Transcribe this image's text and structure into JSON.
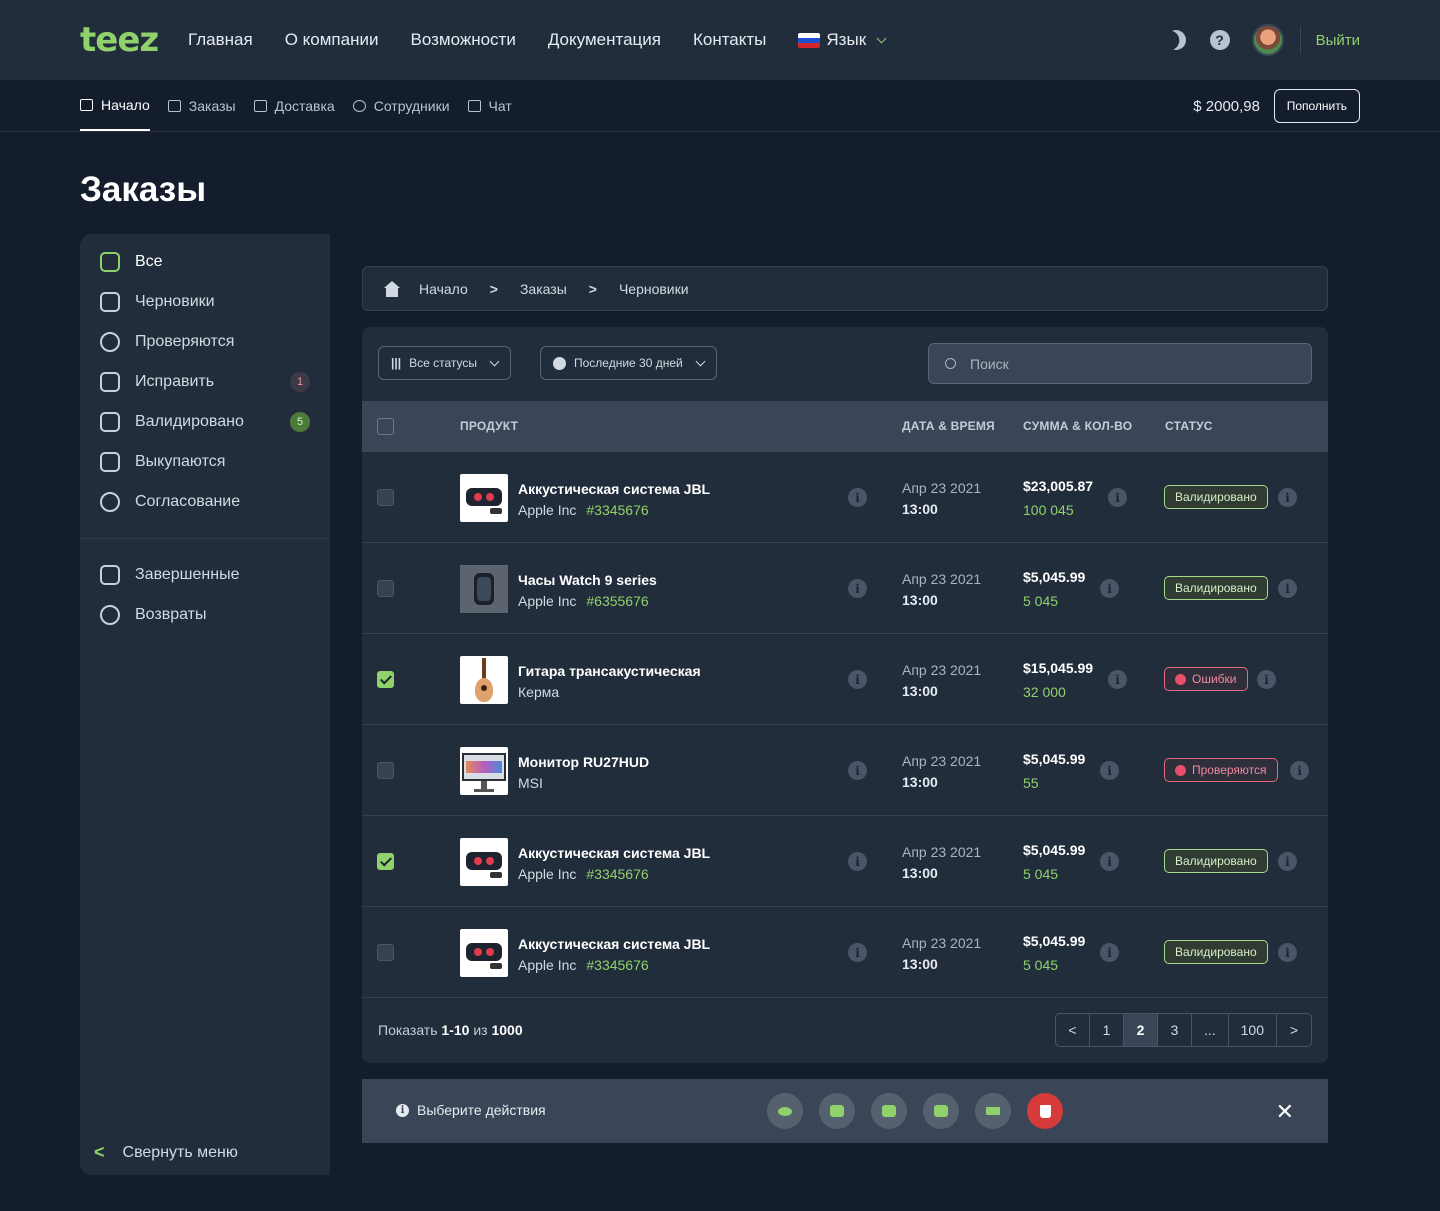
{
  "brand": {
    "logo": "teez"
  },
  "topnav": [
    "Главная",
    "О компании",
    "Возможности",
    "Документация",
    "Контакты"
  ],
  "language": {
    "label": "Язык"
  },
  "top_right": {
    "logout": "Выйти"
  },
  "subnav": [
    {
      "label": "Начало",
      "active": true,
      "icon": "home-icon"
    },
    {
      "label": "Заказы",
      "icon": "bag-icon"
    },
    {
      "label": "Доставка",
      "icon": "truck-icon"
    },
    {
      "label": "Сотрудники",
      "icon": "users-icon"
    },
    {
      "label": "Чат",
      "icon": "chat-icon"
    }
  ],
  "balance": "$ 2000,98",
  "topup_label": "Пополнить",
  "page_title": "Заказы",
  "sidebar": {
    "items": [
      {
        "label": "Все",
        "active": true,
        "icon": "shop-icon"
      },
      {
        "label": "Черновики",
        "icon": "drafts-icon"
      },
      {
        "label": "Проверяются",
        "icon": "review-icon"
      },
      {
        "label": "Исправить",
        "badge": "1",
        "badge_color": "#f08aa0",
        "icon": "basket-x-icon"
      },
      {
        "label": "Валидировано",
        "badge": "5",
        "badge_color": "#4c7a3a",
        "icon": "basket-check-icon"
      },
      {
        "label": "Выкупаются",
        "icon": "cart-icon"
      },
      {
        "label": "Согласование",
        "icon": "bag-approve-icon"
      }
    ],
    "items2": [
      {
        "label": "Завершенные",
        "icon": "archive-icon"
      },
      {
        "label": "Возвраты",
        "icon": "return-icon"
      }
    ],
    "collapse": "Свернуть меню"
  },
  "breadcrumb": [
    "Начало",
    "Заказы",
    "Черновики"
  ],
  "filters": {
    "status": "Все статусы",
    "period": "Последние 30 дней"
  },
  "search": {
    "placeholder": "Поиск"
  },
  "table": {
    "headers": [
      "ПРОДУКТ",
      "ДАТА & ВРЕМЯ",
      "СУММА & КОЛ-ВО",
      "СТАТУС"
    ],
    "rows": [
      {
        "name": "Аккустическая система JBL",
        "brand": "Apple Inc",
        "code": "#3345676",
        "date": "Апр 23 2021",
        "time": "13:00",
        "amount": "$23,005.87",
        "qty": "100 045",
        "status": "Валидировано",
        "status_type": "ok",
        "checked": false,
        "thumb": "speaker"
      },
      {
        "name": "Часы Watch 9 series",
        "brand": "Apple Inc",
        "code": "#6355676",
        "date": "Апр 23 2021",
        "time": "13:00",
        "amount": "$5,045.99",
        "qty": "5 045",
        "status": "Валидировано",
        "status_type": "ok",
        "checked": false,
        "thumb": "watch"
      },
      {
        "name": "Гитара трансакустическая",
        "brand": "Керма",
        "code": "",
        "date": "Апр 23 2021",
        "time": "13:00",
        "amount": "$15,045.99",
        "qty": "32 000",
        "status": "Ошибки",
        "status_type": "err",
        "checked": true,
        "thumb": "guitar"
      },
      {
        "name": "Монитор RU27HUD",
        "brand": "MSI",
        "code": "",
        "date": "Апр 23 2021",
        "time": "13:00",
        "amount": "$5,045.99",
        "qty": "55",
        "status": "Проверяются",
        "status_type": "err",
        "checked": false,
        "thumb": "monitor"
      },
      {
        "name": "Аккустическая система JBL",
        "brand": "Apple Inc",
        "code": "#3345676",
        "date": "Апр 23 2021",
        "time": "13:00",
        "amount": "$5,045.99",
        "qty": "5 045",
        "status": "Валидировано",
        "status_type": "ok",
        "checked": true,
        "thumb": "speaker"
      },
      {
        "name": "Аккустическая система JBL",
        "brand": "Apple Inc",
        "code": "#3345676",
        "date": "Апр 23 2021",
        "time": "13:00",
        "amount": "$5,045.99",
        "qty": "5 045",
        "status": "Валидировано",
        "status_type": "ok",
        "checked": false,
        "thumb": "speaker"
      }
    ]
  },
  "footer": {
    "prefix": "Показать",
    "range": "1-10",
    "of": "из",
    "total": "1000"
  },
  "pagination": [
    "1",
    "2",
    "3",
    "...",
    "100"
  ],
  "pagination_active": "2",
  "actions": {
    "label": "Выберите действия",
    "buttons": [
      "eye-icon",
      "copy-icon",
      "chat-icon",
      "edit-icon",
      "download-icon",
      "trash-icon"
    ]
  },
  "colors": {
    "accent": "#8fd16a",
    "danger": "#d63a3a",
    "bg": "#141d2b",
    "panel": "#222d3b"
  }
}
